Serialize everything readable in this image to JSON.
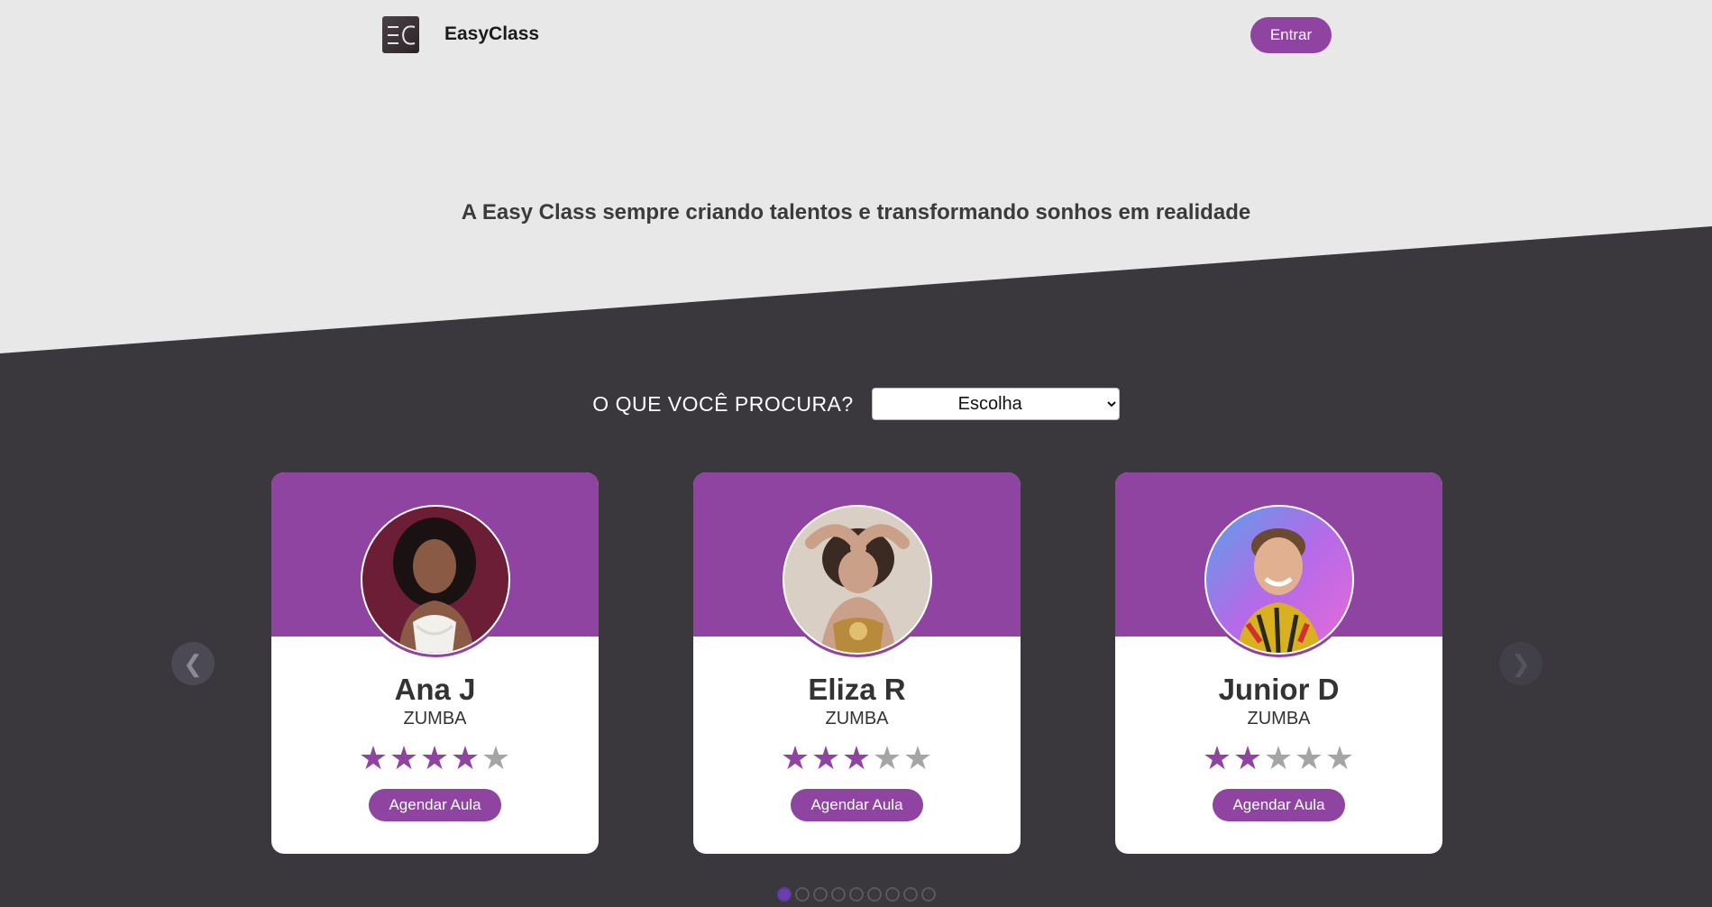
{
  "header": {
    "brand": "EasyClass",
    "login_label": "Entrar"
  },
  "hero": {
    "tagline": "A Easy Class sempre criando talentos e transformando sonhos em realidade"
  },
  "search": {
    "label": "O QUE VOCÊ PROCURA?",
    "selected": "Escolha"
  },
  "carousel": {
    "prev_icon": "❮",
    "next_icon": "❯",
    "cards": [
      {
        "name": "Ana J",
        "category": "ZUMBA",
        "rating": 4,
        "max_rating": 5,
        "button": "Agendar Aula",
        "photo": "portrait-woman-curly-hair"
      },
      {
        "name": "Eliza R",
        "category": "ZUMBA",
        "rating": 3,
        "max_rating": 5,
        "button": "Agendar Aula",
        "photo": "portrait-woman-dancer"
      },
      {
        "name": "Junior D",
        "category": "ZUMBA",
        "rating": 2,
        "max_rating": 5,
        "button": "Agendar Aula",
        "photo": "portrait-man-smiling"
      }
    ],
    "pages": 9,
    "active_page": 1
  },
  "colors": {
    "accent": "#8e44a0",
    "dark_bg": "#3a383c",
    "light_bg": "#e8e8e8"
  }
}
